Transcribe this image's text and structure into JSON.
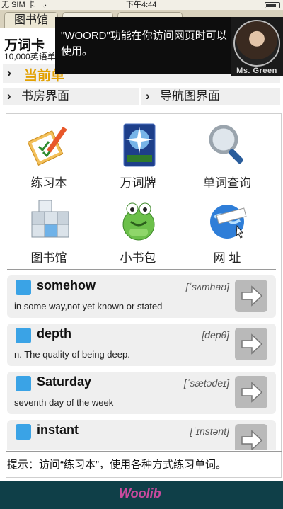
{
  "status_bar": {
    "carrier": "无 SIM 卡",
    "time": "下午4:44"
  },
  "tabs": [
    {
      "label": "图书馆"
    },
    {
      "label": ""
    },
    {
      "label": ""
    }
  ],
  "header": {
    "title": "万词卡",
    "subtitle": "10,000英语单"
  },
  "nav": {
    "current": "当前单",
    "links": [
      "书房界面",
      "导航图界面"
    ]
  },
  "tooltip": {
    "text": "\"WOORD\"功能在你访问网页时可以使用。",
    "avatar_name": "Ms. Green"
  },
  "grid": [
    {
      "label": "练习本",
      "icon": "notebook-icon"
    },
    {
      "label": "万词牌",
      "icon": "word-card-icon"
    },
    {
      "label": "单词查询",
      "icon": "magnifier-icon"
    },
    {
      "label": "图书馆",
      "icon": "library-cubes-icon"
    },
    {
      "label": "小书包",
      "icon": "backpack-icon"
    },
    {
      "label": "网 址",
      "icon": "globe-icon"
    }
  ],
  "words": [
    {
      "word": "somehow",
      "phonetic": "[ˈsʌmhaʊ]",
      "definition": "in some way,not yet known or stated"
    },
    {
      "word": "depth",
      "phonetic": "[depθ]",
      "definition": "n. The quality of being deep."
    },
    {
      "word": "Saturday",
      "phonetic": "[ˈsætədeɪ]",
      "definition": "seventh day of the week"
    },
    {
      "word": "instant",
      "phonetic": "[ˈɪnstənt]",
      "definition": ""
    }
  ],
  "hint": "提示：访问“练习本”，使用各种方式练习单词。",
  "footer": {
    "brand": "Woolib"
  },
  "colors": {
    "accent_orange": "#e2a000",
    "word_marker": "#3aa3e6",
    "footer_bg": "#0f3f48"
  }
}
